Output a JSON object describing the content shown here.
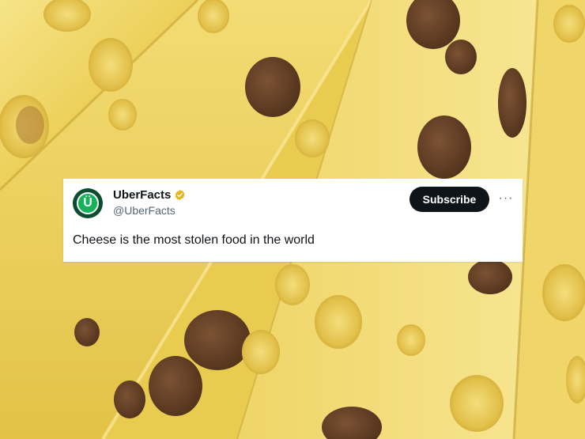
{
  "tweet": {
    "display_name": "UberFacts",
    "handle": "@UberFacts",
    "avatar_letter": "Ü",
    "subscribe_label": "Subscribe",
    "more_label": "···",
    "text": "Cheese is the most stolen food in the world",
    "verified_icon": "verified-badge-icon",
    "verified_color": "#e2b719"
  },
  "colors": {
    "cheese_light": "#f3de7a",
    "cheese_mid": "#e8c84a",
    "cheese_dark": "#caa22c",
    "hole": "#6b4528",
    "button_bg": "#0f1419",
    "avatar_outer": "#0b4d2f",
    "avatar_inner": "#14b35a"
  }
}
